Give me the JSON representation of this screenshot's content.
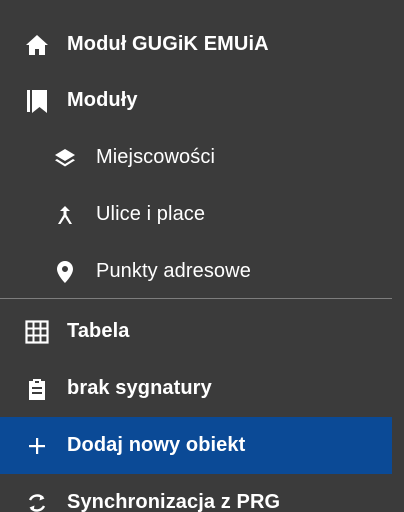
{
  "menu": {
    "items": [
      {
        "label": "Moduł GUGiK EMUiA",
        "icon": "home-icon"
      },
      {
        "label": "Moduły",
        "icon": "bookmark-icon"
      },
      {
        "label": "Miejscowości",
        "icon": "layers-icon"
      },
      {
        "label": "Ulice i place",
        "icon": "merge-icon"
      },
      {
        "label": "Punkty adresowe",
        "icon": "map-marker-icon"
      },
      {
        "label": "Tabela",
        "icon": "table-icon"
      },
      {
        "label": "brak sygnatury",
        "icon": "clipboard-icon"
      },
      {
        "label": "Dodaj nowy obiekt",
        "icon": "plus-icon"
      },
      {
        "label": "Synchronizacja z PRG",
        "icon": "sync-icon"
      }
    ]
  },
  "colors": {
    "background": "#3b3b3b",
    "active": "#0b4a96",
    "text": "#ffffff",
    "divider": "#7d7d7d"
  }
}
